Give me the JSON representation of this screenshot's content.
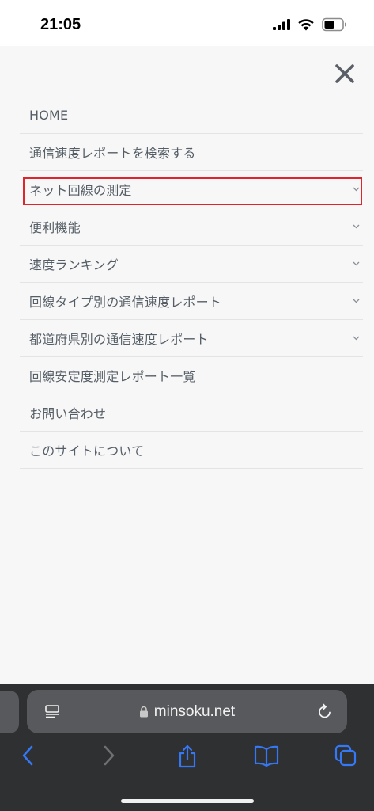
{
  "status_bar": {
    "time": "21:05",
    "icons": [
      "cellular-signal-icon",
      "wifi-icon",
      "battery-icon"
    ]
  },
  "menu": {
    "close_icon": "close-icon",
    "items": [
      {
        "label": "HOME",
        "expandable": false
      },
      {
        "label": "通信速度レポートを検索する",
        "expandable": false
      },
      {
        "label": "ネット回線の測定",
        "expandable": true,
        "highlighted": true
      },
      {
        "label": "便利機能",
        "expandable": true
      },
      {
        "label": "速度ランキング",
        "expandable": true
      },
      {
        "label": "回線タイプ別の通信速度レポート",
        "expandable": true
      },
      {
        "label": "都道府県別の通信速度レポート",
        "expandable": true
      },
      {
        "label": "回線安定度測定レポート一覧",
        "expandable": false
      },
      {
        "label": "お問い合わせ",
        "expandable": false
      },
      {
        "label": "このサイトについて",
        "expandable": false
      }
    ]
  },
  "browser": {
    "url": "minsoku.net",
    "toolbar": [
      "back-icon",
      "forward-icon",
      "share-icon",
      "bookmarks-icon",
      "tabs-icon"
    ]
  },
  "colors": {
    "highlight": "#e0242d",
    "accent": "#3478f6",
    "menu_text": "#555e66",
    "toolbar_bg": "#2f3032"
  }
}
